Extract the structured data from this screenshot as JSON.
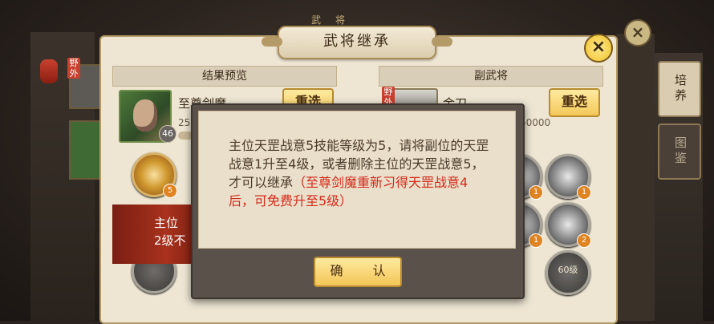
{
  "background": {
    "title": "武将",
    "side_tabs": [
      {
        "label": "培养",
        "active": true
      },
      {
        "label": "图鉴",
        "active": false
      }
    ]
  },
  "panel": {
    "title": "武将继承",
    "left": {
      "header": "结果预览",
      "hero_name": "至尊剑魔",
      "hero_level": "46",
      "power_partial": "25",
      "reselect_label": "重选",
      "skills": [
        {
          "icon": "taiji-icon",
          "badge": "5"
        }
      ],
      "banner_line1": "主位",
      "banner_line2": "2级不"
    },
    "right": {
      "header": "副武将",
      "hero_name": "金刀",
      "wild_tag": "野外",
      "power_partial": "50000",
      "reselect_label": "重选",
      "skills": [
        {
          "icon": "taiji-icon",
          "badge": "1"
        },
        {
          "icon": "sword-icon",
          "badge": "2"
        },
        {
          "icon": "skill-icon",
          "level": "60级"
        }
      ],
      "skill_badges_partial": [
        "1",
        "1"
      ]
    }
  },
  "dialog": {
    "message_main": "主位天罡战意5技能等级为5，请将副位的天罡战意1升至4级，或者删除主位的天罡战意5，才可以继承",
    "message_note": "（至尊剑魔重新习得天罡战意4后，可免费升至5级）",
    "confirm_label": "确 认"
  },
  "colors": {
    "accent_yellow": "#f3c85a",
    "warning_red": "#d42a1c",
    "parchment": "#eee6d3"
  }
}
